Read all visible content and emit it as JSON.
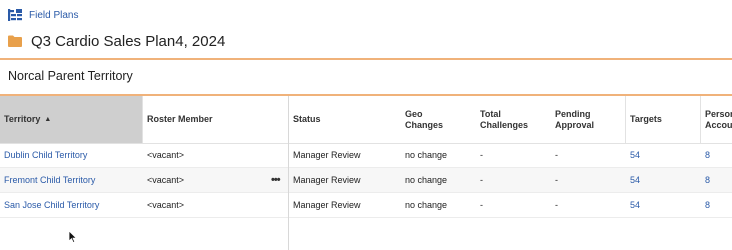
{
  "breadcrumb": {
    "label": "Field Plans",
    "icon": "hierarchy-icon"
  },
  "header": {
    "title": "Q3 Cardio Sales Plan4, 2024",
    "icon": "folder-icon",
    "icon_color": "#e8a04b"
  },
  "section": {
    "title": "Norcal Parent Territory"
  },
  "table": {
    "columns": [
      {
        "label": "Territory",
        "sorted": "ascending"
      },
      {
        "label": "Roster Member"
      },
      {
        "label": "Status"
      },
      {
        "label": "Geo Changes"
      },
      {
        "label": "Total Challenges"
      },
      {
        "label": "Pending Approval"
      },
      {
        "label": "Targets"
      },
      {
        "label": "Person Accou"
      }
    ],
    "rows": [
      {
        "territory": "Dublin Child Territory",
        "roster": "<vacant>",
        "status": "Manager Review",
        "geo": "no change",
        "total": "-",
        "pending": "-",
        "targets": "54",
        "person": "8"
      },
      {
        "territory": "Fremont Child Territory",
        "roster": "<vacant>",
        "status": "Manager Review",
        "geo": "no change",
        "total": "-",
        "pending": "-",
        "targets": "54",
        "person": "8",
        "more": "•••"
      },
      {
        "territory": "San Jose Child Territory",
        "roster": "<vacant>",
        "status": "Manager Review",
        "geo": "no change",
        "total": "-",
        "pending": "-",
        "targets": "54",
        "person": "8"
      }
    ]
  },
  "colors": {
    "accent_line": "#f0b27a",
    "link": "#2a5aa8",
    "sorted_header": "#cfcfcf"
  }
}
